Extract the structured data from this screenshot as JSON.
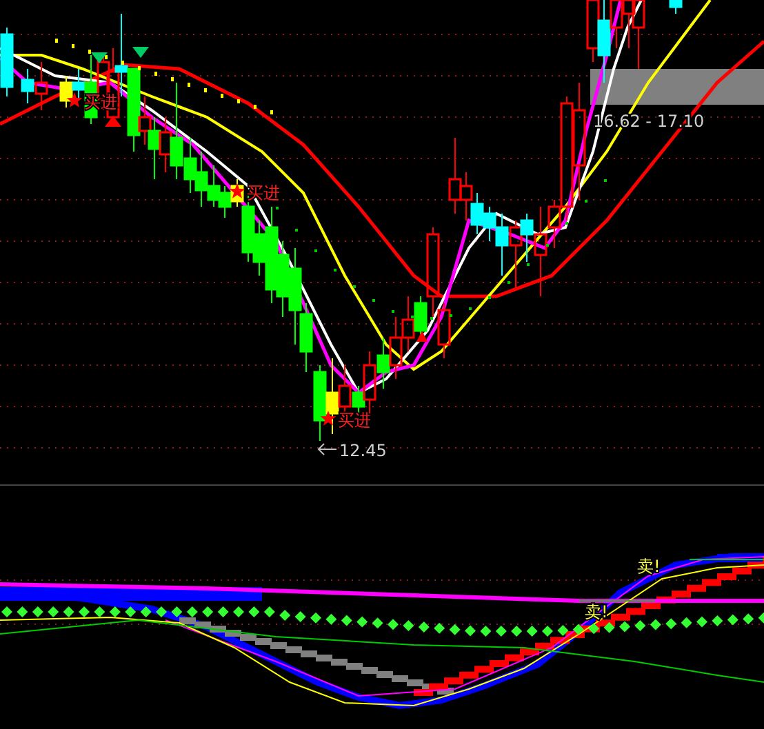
{
  "main_chart": {
    "buy_signals": [
      {
        "label": "买进"
      },
      {
        "label": "买进"
      },
      {
        "label": "买进"
      }
    ],
    "price_range": {
      "label": "16.62 - 17.10"
    },
    "low_marker": {
      "label": "12.45"
    }
  },
  "indicator_chart": {
    "sell_signals": [
      {
        "label": "卖!"
      },
      {
        "label": "卖!"
      }
    ]
  }
}
